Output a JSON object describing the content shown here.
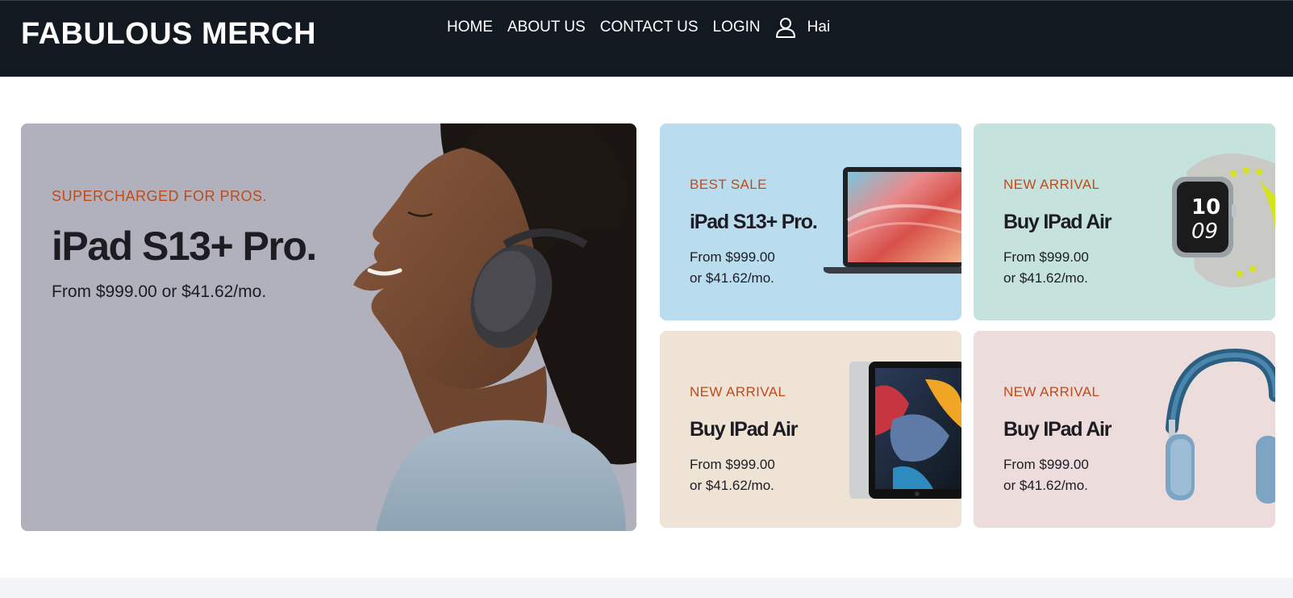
{
  "header": {
    "brand": "FABULOUS MERCH",
    "nav": [
      "HOME",
      "ABOUT US",
      "CONTACT US",
      "LOGIN"
    ],
    "user_name": "Hai"
  },
  "hero": {
    "kicker": "SUPERCHARGED FOR PROS.",
    "title": "iPad S13+ Pro.",
    "price": "From $999.00 or $41.62/mo."
  },
  "cards": [
    {
      "kicker": "BEST SALE",
      "title": "iPad S13+ Pro.",
      "price_line1": "From $999.00",
      "price_line2": "or $41.62/mo.",
      "image": "laptop"
    },
    {
      "kicker": "NEW ARRIVAL",
      "title": "Buy IPad Air",
      "price_line1": "From $999.00",
      "price_line2": "or $41.62/mo.",
      "image": "smartwatch"
    },
    {
      "kicker": "NEW ARRIVAL",
      "title": "Buy IPad Air",
      "price_line1": "From $999.00",
      "price_line2": "or $41.62/mo.",
      "image": "tablet"
    },
    {
      "kicker": "NEW ARRIVAL",
      "title": "Buy IPad Air",
      "price_line1": "From $999.00",
      "price_line2": "or $41.62/mo.",
      "image": "headphones"
    }
  ],
  "colors": {
    "header_bg": "#131921",
    "accent": "#bd4b1b",
    "hero_bg": "#b0b0bc",
    "card1_bg": "#badcef",
    "card2_bg": "#c6e2dc",
    "card3_bg": "#efe3d6",
    "card4_bg": "#ecdcdc"
  },
  "icons": {
    "user": "user-icon"
  }
}
